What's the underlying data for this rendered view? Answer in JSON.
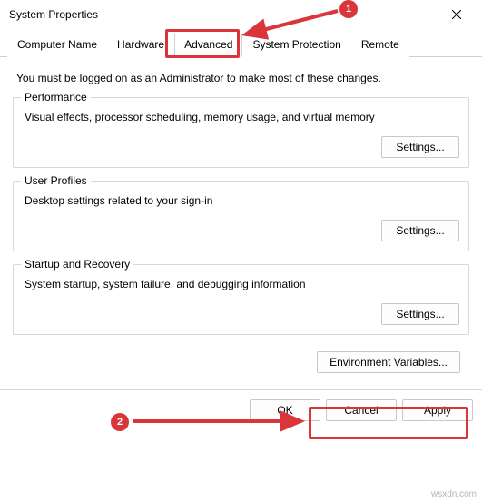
{
  "window": {
    "title": "System Properties"
  },
  "tabs": {
    "computer_name": "Computer Name",
    "hardware": "Hardware",
    "advanced": "Advanced",
    "system_protection": "System Protection",
    "remote": "Remote"
  },
  "intro": "You must be logged on as an Administrator to make most of these changes.",
  "groups": {
    "performance": {
      "title": "Performance",
      "desc": "Visual effects, processor scheduling, memory usage, and virtual memory",
      "button": "Settings..."
    },
    "user_profiles": {
      "title": "User Profiles",
      "desc": "Desktop settings related to your sign-in",
      "button": "Settings..."
    },
    "startup_recovery": {
      "title": "Startup and Recovery",
      "desc": "System startup, system failure, and debugging information",
      "button": "Settings..."
    }
  },
  "env_button": "Environment Variables...",
  "footer": {
    "ok": "OK",
    "cancel": "Cancel",
    "apply": "Apply"
  },
  "annotations": {
    "badge1": "1",
    "badge2": "2"
  },
  "watermark": "wsxdn.com"
}
